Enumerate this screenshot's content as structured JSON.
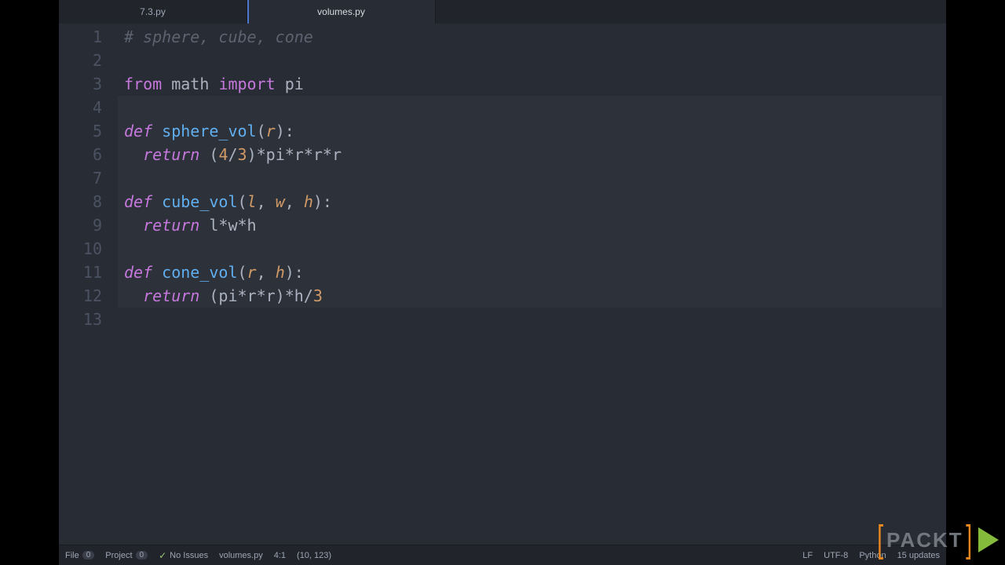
{
  "tabs": [
    {
      "label": "7.3.py",
      "active": false
    },
    {
      "label": "volumes.py",
      "active": true
    }
  ],
  "gutter_start": 1,
  "gutter_end": 13,
  "highlight": {
    "from": 4,
    "to": 12
  },
  "code": {
    "l1_comment": "# sphere, cube, cone",
    "l3_from": "from",
    "l3_math": "math",
    "l3_import": "import",
    "l3_pi": "pi",
    "l5_def": "def",
    "l5_fn": "sphere_vol",
    "l5_p1": "r",
    "l6_return": "return",
    "l6_expr_a": "(",
    "l6_n4": "4",
    "l6_slash": "/",
    "l6_n3": "3",
    "l6_expr_b": ")*pi*r*r*r",
    "l8_def": "def",
    "l8_fn": "cube_vol",
    "l8_p1": "l",
    "l8_p2": "w",
    "l8_p3": "h",
    "l9_return": "return",
    "l9_expr": "l*w*h",
    "l11_def": "def",
    "l11_fn": "cone_vol",
    "l11_p1": "r",
    "l11_p2": "h",
    "l12_return": "return",
    "l12_expr_a": "(pi*r*r)*h/",
    "l12_n3": "3"
  },
  "status": {
    "file_label": "File",
    "file_count": "0",
    "project_label": "Project",
    "project_count": "0",
    "issues": "No Issues",
    "filename": "volumes.py",
    "cursor": "4:1",
    "selection": "(10, 123)",
    "line_ending": "LF",
    "encoding": "UTF-8",
    "language": "Python",
    "updates": "15 updates"
  },
  "branding": "PACKT"
}
